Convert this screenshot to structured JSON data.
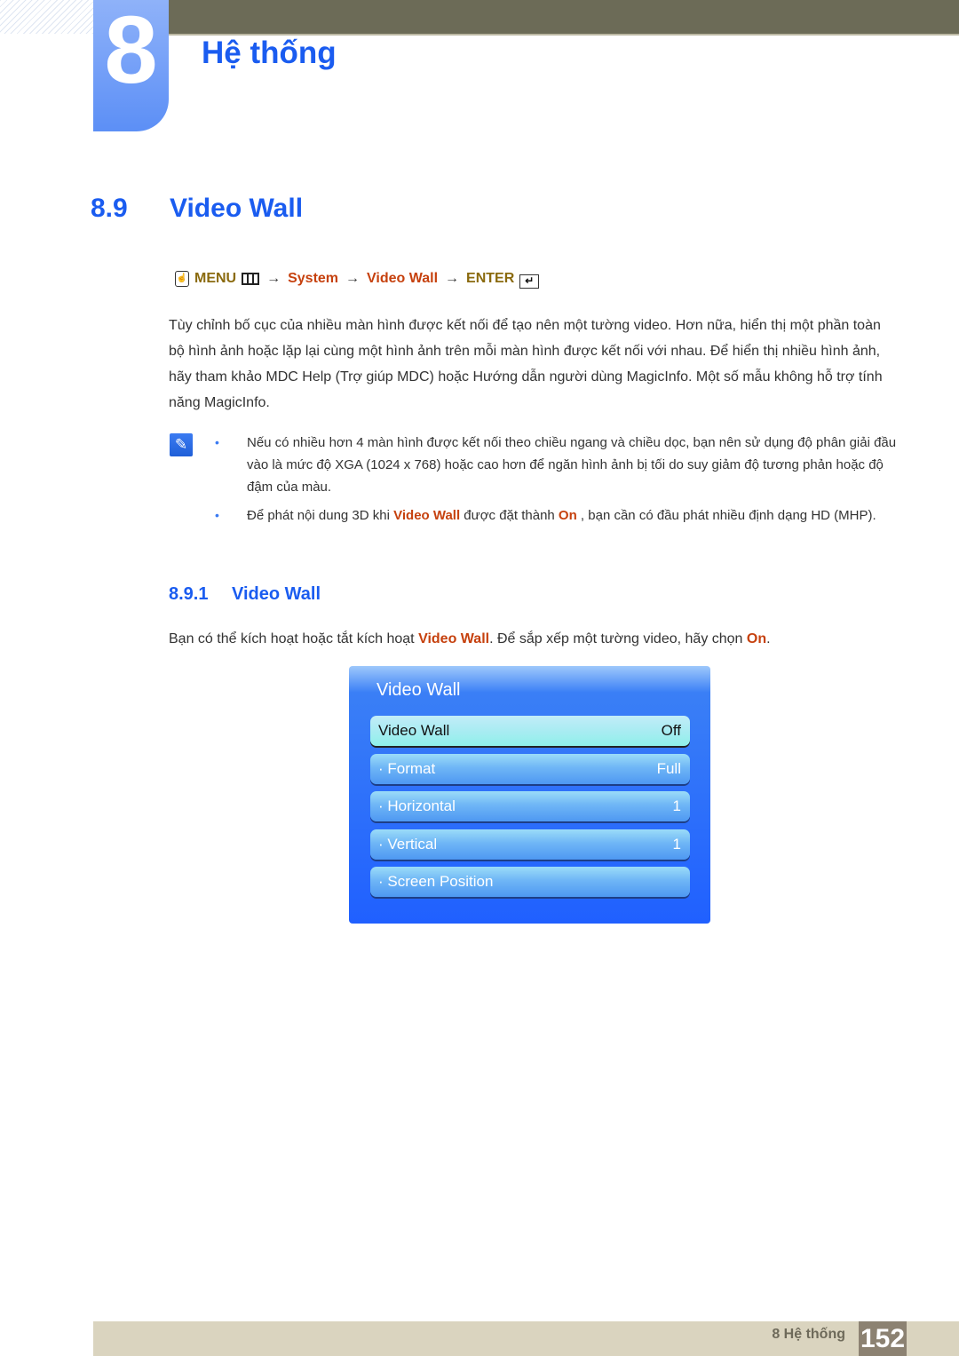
{
  "header": {
    "chapter_number": "8",
    "chapter_title": "Hệ thống"
  },
  "section": {
    "number": "8.9",
    "title": "Video Wall"
  },
  "menu_path": {
    "hand_icon": "remote-hand-icon",
    "menu_label": "MENU",
    "menu_icon": "menu-grid-icon",
    "arrow": "→",
    "steps": [
      "System",
      "Video Wall"
    ],
    "enter_label": "ENTER",
    "enter_icon": "enter-icon"
  },
  "body": {
    "paragraph": "Tùy chỉnh bố cục của nhiều màn hình được kết nối để tạo nên một tường video. Hơn nữa, hiển thị một phần toàn bộ hình ảnh hoặc lặp lại cùng một hình ảnh trên mỗi màn hình được kết nối với nhau. Để hiển thị nhiều hình ảnh, hãy tham khảo MDC Help (Trợ giúp MDC) hoặc Hướng dẫn người dùng MagicInfo. Một số mẫu không hỗ trợ tính năng MagicInfo."
  },
  "notes": {
    "icon": "note-pencil-icon",
    "bullet": "•",
    "items": [
      {
        "text": "Nếu có nhiều hơn 4 màn hình được kết nối theo chiều ngang và chiều dọc, bạn nên sử dụng độ phân giải đầu vào là mức độ XGA (1024 x 768) hoặc cao hơn để ngăn hình ảnh bị tối do suy giảm độ tương phản hoặc độ đậm của màu."
      },
      {
        "pre": "Để phát nội dung 3D khi ",
        "hl1": "Video Wall",
        "mid": " được đặt thành ",
        "hl2": "On",
        "post": " , bạn cần có đầu phát nhiều định dạng HD (MHP)."
      }
    ]
  },
  "subsection": {
    "number": "8.9.1",
    "title": "Video Wall",
    "intro_pre": "Bạn có thể kích hoạt hoặc tắt kích hoạt ",
    "intro_hl1": "Video Wall",
    "intro_mid": ". Để sắp xếp một tường video, hãy chọn ",
    "intro_hl2": "On",
    "intro_post": "."
  },
  "osd_menu": {
    "title": "Video Wall",
    "items": [
      {
        "label": "Video Wall",
        "value": "Off",
        "selected": true
      },
      {
        "label": "· Format",
        "value": "Full"
      },
      {
        "label": "· Horizontal",
        "value": "1"
      },
      {
        "label": "· Vertical",
        "value": "1"
      },
      {
        "label": "· Screen Position",
        "value": ""
      }
    ]
  },
  "footer": {
    "chapter_label": "8 Hệ thống",
    "page_number": "152"
  },
  "colors": {
    "heading_blue": "#1a5cf0",
    "highlight_red": "#c6410e",
    "menu_gold": "#8a6a0e",
    "topbar": "#6c6b57",
    "footer_bg": "#dad4bf",
    "page_box": "#8c8272"
  }
}
